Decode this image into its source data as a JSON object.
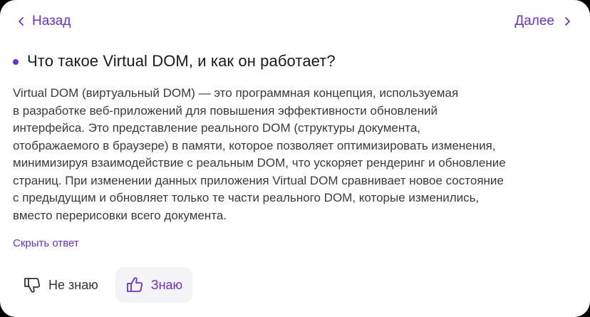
{
  "nav": {
    "back_label": "Назад",
    "next_label": "Далее"
  },
  "question": {
    "text": "Что такое Virtual DOM, и как он работает?"
  },
  "answer": {
    "lines": [
      "Virtual DOM (виртуальный DOM) — это программная концепция, используемая",
      "в разработке веб-приложений для повышения эффективности обновлений",
      "интерфейса. Это представление реального DOM (структуры документа,",
      "отображаемого в браузере) в памяти, которое позволяет оптимизировать изменения,",
      "минимизируя взаимодействие с реальным DOM, что ускоряет рендеринг и обновление",
      "страниц. При изменении данных приложения Virtual DOM сравнивает новое состояние",
      "с предыдущим и обновляет только те части реального DOM, которые изменились,",
      "вместо перерисовки всего документа."
    ]
  },
  "hide_answer_label": "Скрыть ответ",
  "feedback": {
    "dont_know_label": "Не знаю",
    "know_label": "Знаю"
  },
  "icons": {
    "back": "chevron-left-icon",
    "next": "chevron-right-icon",
    "dont_know": "thumbs-down-icon",
    "know": "thumbs-up-icon"
  },
  "colors": {
    "accent": "#6a2fd6",
    "text": "#1a1a1a",
    "body_text": "#3a3a3a",
    "know_button_bg": "#f4f4f6",
    "background": "#000000",
    "card": "#ffffff"
  }
}
